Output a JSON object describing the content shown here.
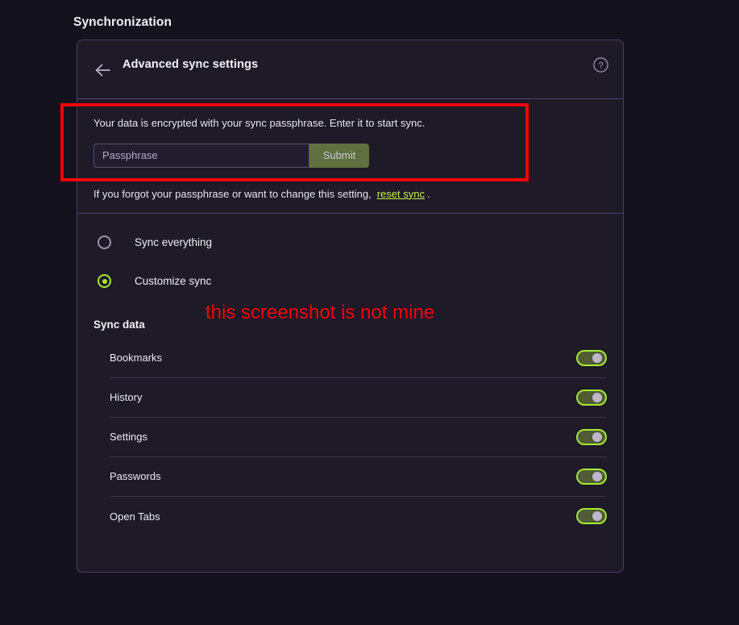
{
  "page": {
    "title": "Synchronization",
    "background_color": "#14121c"
  },
  "card": {
    "header": {
      "back_icon": "arrow-left-icon",
      "title": "Advanced sync settings",
      "help_icon": "question-circle-icon"
    },
    "passphrase": {
      "prompt": "Your data is encrypted with your sync passphrase. Enter it to start sync.",
      "input_value": "",
      "input_placeholder": "Passphrase",
      "submit_label": "Submit"
    },
    "reset": {
      "text_before": "If you forgot your passphrase or want to change this setting,",
      "link_label": "reset sync",
      "text_after": "."
    },
    "sync_mode": {
      "options": [
        {
          "label": "Sync everything",
          "selected": false
        },
        {
          "label": "Customize sync",
          "selected": true
        }
      ]
    },
    "sync_data": {
      "heading": "Sync data",
      "items": [
        {
          "label": "Bookmarks",
          "enabled": true
        },
        {
          "label": "History",
          "enabled": true
        },
        {
          "label": "Settings",
          "enabled": true
        },
        {
          "label": "Passwords",
          "enabled": true
        },
        {
          "label": "Open Tabs",
          "enabled": true
        }
      ]
    }
  },
  "annotations": {
    "highlight_box_color": "#fb0007",
    "note_text": "this screenshot is not mine",
    "note_color": "#f40009"
  },
  "colors": {
    "accent_green": "#a8e831",
    "link_green": "#c6f04a",
    "submit_green": "#607040",
    "card_background": "#1e1a28",
    "card_border": "#4a3d63",
    "divider": "#514369"
  }
}
